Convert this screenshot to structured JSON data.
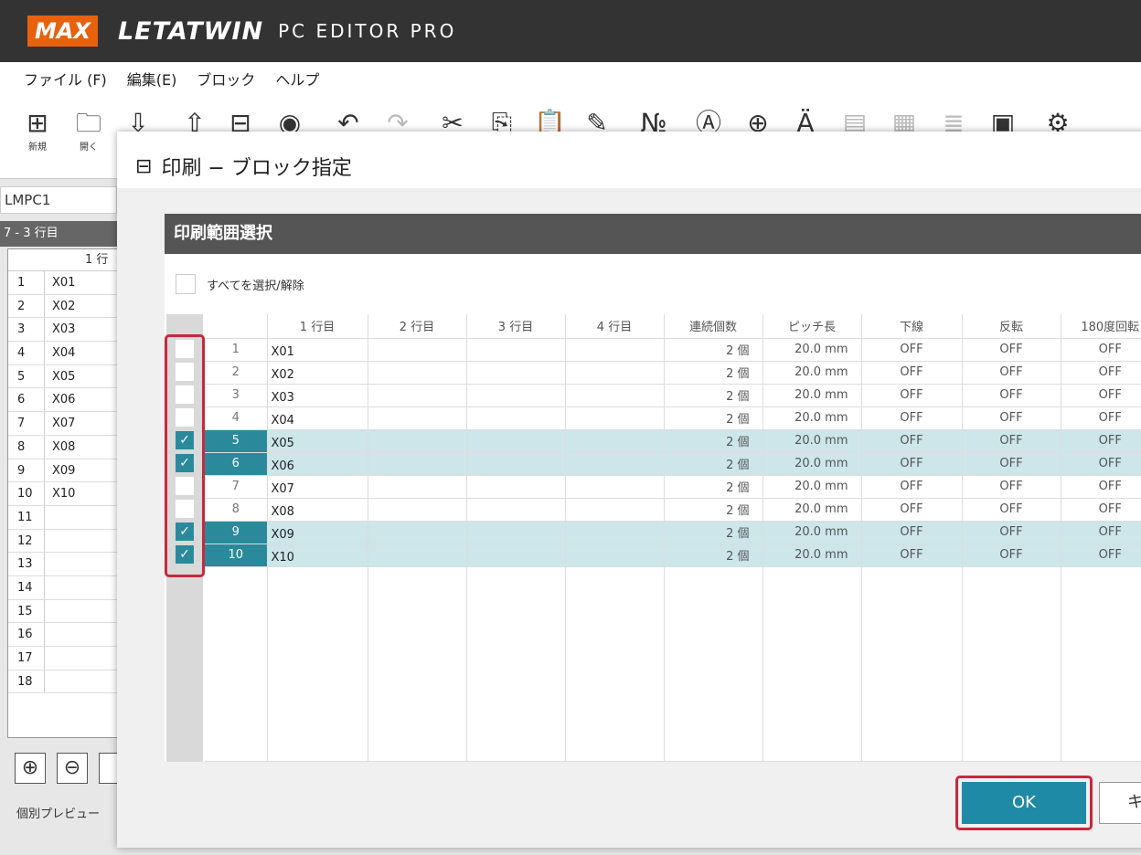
{
  "app": {
    "logo": "MAX",
    "brand": "LETATWIN",
    "product": "PC EDITOR PRO"
  },
  "menu": [
    "ファイル (F)",
    "編集(E)",
    "ブロック",
    "ヘルプ"
  ],
  "toolbar": {
    "new_label": "新規",
    "open_label": "開く"
  },
  "left_panel": {
    "doc_name": "LMPC1",
    "row_header": "7 - 3 行目",
    "col_header": "1 行",
    "rows": [
      {
        "n": "1",
        "v": "X01"
      },
      {
        "n": "2",
        "v": "X02"
      },
      {
        "n": "3",
        "v": "X03"
      },
      {
        "n": "4",
        "v": "X04"
      },
      {
        "n": "5",
        "v": "X05"
      },
      {
        "n": "6",
        "v": "X06"
      },
      {
        "n": "7",
        "v": "X07"
      },
      {
        "n": "8",
        "v": "X08"
      },
      {
        "n": "9",
        "v": "X09"
      },
      {
        "n": "10",
        "v": "X10"
      },
      {
        "n": "11",
        "v": ""
      },
      {
        "n": "12",
        "v": ""
      },
      {
        "n": "13",
        "v": ""
      },
      {
        "n": "14",
        "v": ""
      },
      {
        "n": "15",
        "v": ""
      },
      {
        "n": "16",
        "v": ""
      },
      {
        "n": "17",
        "v": ""
      },
      {
        "n": "18",
        "v": ""
      }
    ],
    "preview_label": "個別プレビュー"
  },
  "dialog": {
    "title": "印刷 − ブロック指定",
    "section_title": "印刷範囲選択",
    "select_all_label": "すべてを選択/解除",
    "columns": [
      "1 行目",
      "2 行目",
      "3 行目",
      "4 行目",
      "連続個数",
      "ピッチ長",
      "下線",
      "反転",
      "180度回転"
    ],
    "rows": [
      {
        "no": "1",
        "r1": "X01",
        "count": "2 個",
        "pitch": "20.0 mm",
        "underline": "OFF",
        "invert": "OFF",
        "rotate": "OFF",
        "checked": false
      },
      {
        "no": "2",
        "r1": "X02",
        "count": "2 個",
        "pitch": "20.0 mm",
        "underline": "OFF",
        "invert": "OFF",
        "rotate": "OFF",
        "checked": false
      },
      {
        "no": "3",
        "r1": "X03",
        "count": "2 個",
        "pitch": "20.0 mm",
        "underline": "OFF",
        "invert": "OFF",
        "rotate": "OFF",
        "checked": false
      },
      {
        "no": "4",
        "r1": "X04",
        "count": "2 個",
        "pitch": "20.0 mm",
        "underline": "OFF",
        "invert": "OFF",
        "rotate": "OFF",
        "checked": false
      },
      {
        "no": "5",
        "r1": "X05",
        "count": "2 個",
        "pitch": "20.0 mm",
        "underline": "OFF",
        "invert": "OFF",
        "rotate": "OFF",
        "checked": true
      },
      {
        "no": "6",
        "r1": "X06",
        "count": "2 個",
        "pitch": "20.0 mm",
        "underline": "OFF",
        "invert": "OFF",
        "rotate": "OFF",
        "checked": true
      },
      {
        "no": "7",
        "r1": "X07",
        "count": "2 個",
        "pitch": "20.0 mm",
        "underline": "OFF",
        "invert": "OFF",
        "rotate": "OFF",
        "checked": false
      },
      {
        "no": "8",
        "r1": "X08",
        "count": "2 個",
        "pitch": "20.0 mm",
        "underline": "OFF",
        "invert": "OFF",
        "rotate": "OFF",
        "checked": false
      },
      {
        "no": "9",
        "r1": "X09",
        "count": "2 個",
        "pitch": "20.0 mm",
        "underline": "OFF",
        "invert": "OFF",
        "rotate": "OFF",
        "checked": true
      },
      {
        "no": "10",
        "r1": "X10",
        "count": "2 個",
        "pitch": "20.0 mm",
        "underline": "OFF",
        "invert": "OFF",
        "rotate": "OFF",
        "checked": true
      }
    ],
    "ok_label": "OK",
    "cancel_label": "キ"
  },
  "colors": {
    "accent": "#1f8aa5",
    "selected_row": "#cce6ea",
    "highlight": "#c8283c",
    "logo": "#e8620e"
  }
}
